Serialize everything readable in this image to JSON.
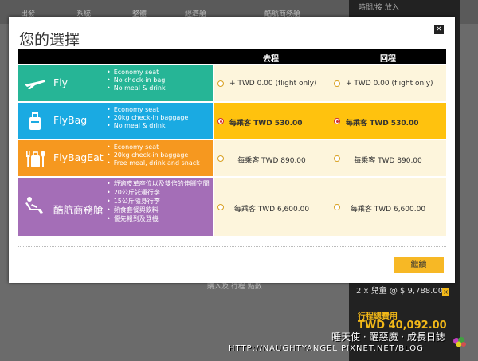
{
  "background": {
    "columns": [
      "出發",
      "系統",
      "整體",
      "經濟艙",
      "酷航商務艙"
    ],
    "side_top": "時間/接 放入",
    "side_price": "2 x 兒童 @ $ 9,788.00",
    "side_label": "行程總費用",
    "side_total": "TWD 40,092.00",
    "left_text": "購入及 行程 點數"
  },
  "watermark": {
    "line1": "睡天使 · 醒惡魔 · 成長日誌",
    "line2": "HTTP://NAUGHTYANGEL.PIXNET.NET/BLOG"
  },
  "modal": {
    "title": "您的選擇",
    "close_label": "×",
    "header": {
      "blank": "",
      "outbound": "去程",
      "return": "回程"
    },
    "rows": [
      {
        "name": "Fly",
        "color": "#26b596",
        "icon": "plane-icon",
        "features": [
          "Economy seat",
          "No check-in bag",
          "No meal & drink"
        ],
        "outbound": "+ TWD 0.00 (flight only)",
        "return": "+ TWD 0.00 (flight only)",
        "selected": false
      },
      {
        "name": "FlyBag",
        "color": "#1aaae2",
        "icon": "luggage-icon",
        "features": [
          "Economy seat",
          "20kg check-in baggage",
          "No meal & drink"
        ],
        "outbound": "每乘客 TWD 530.00",
        "return": "每乘客 TWD 530.00",
        "selected": true
      },
      {
        "name": "FlyBagEat",
        "color": "#f6981f",
        "icon": "luggage-meal-icon",
        "features": [
          "Economy seat",
          "20kg check-in baggage",
          "Free meal, drink and snack"
        ],
        "outbound": "每乘客 TWD 890.00",
        "return": "每乘客 TWD 890.00",
        "selected": false
      },
      {
        "name": "酷航商務艙",
        "color": "#a46eb7",
        "icon": "reclining-seat-icon",
        "features": [
          "舒適皮革座位以及雙倍的伸腳空間",
          "20公斤託運行李",
          "15公斤隨身行李",
          "熱食套餐與飲料",
          "優先報到及登機"
        ],
        "outbound": "每乘客 TWD 6,600.00",
        "return": "每乘客 TWD 6,600.00",
        "selected": false
      }
    ],
    "continue_label": "繼續"
  },
  "colors": {
    "option_bg": "#fdf5dc",
    "option_selected_bg": "#ffc20e",
    "accent": "#f7b825"
  }
}
